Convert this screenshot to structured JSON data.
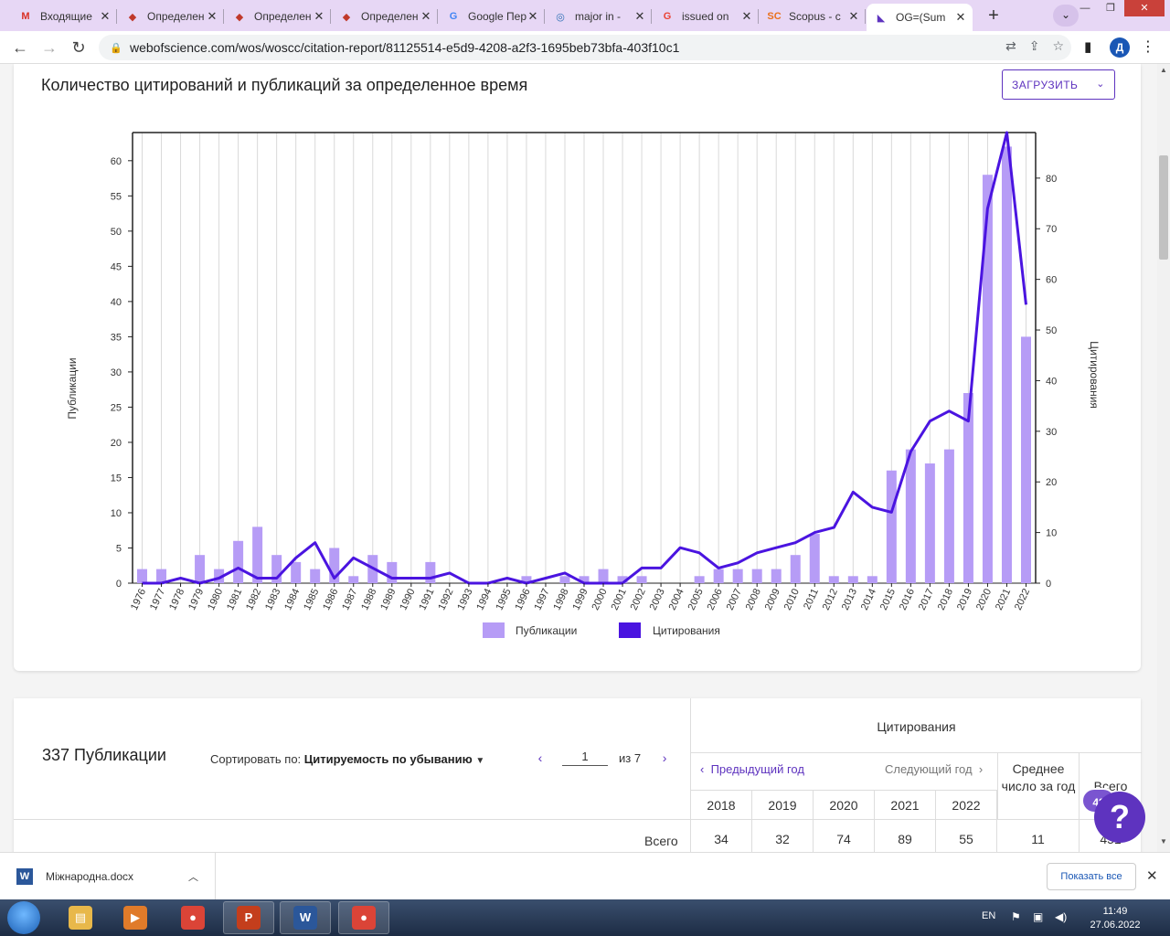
{
  "browser": {
    "tabs": [
      {
        "title": "Входящие",
        "icon": "gmail-icon",
        "icon_glyph": "M",
        "icon_color": "#d93025"
      },
      {
        "title": "Определен",
        "icon": "shield-icon",
        "icon_glyph": "◆",
        "icon_color": "#c0392b"
      },
      {
        "title": "Определен",
        "icon": "shield-icon",
        "icon_glyph": "◆",
        "icon_color": "#c0392b"
      },
      {
        "title": "Определен",
        "icon": "shield-icon",
        "icon_glyph": "◆",
        "icon_color": "#c0392b"
      },
      {
        "title": "Google Пер",
        "icon": "translate-icon",
        "icon_glyph": "G",
        "icon_color": "#4285f4"
      },
      {
        "title": "major in -",
        "icon": "search-icon",
        "icon_glyph": "◎",
        "icon_color": "#2c6fb5"
      },
      {
        "title": "issued on",
        "icon": "google-icon",
        "icon_glyph": "G",
        "icon_color": "#ea4335"
      },
      {
        "title": "Scopus - c",
        "icon": "scopus-icon",
        "icon_glyph": "SC",
        "icon_color": "#e9711c"
      },
      {
        "title": "OG=(Sum",
        "icon": "clarivate-icon",
        "icon_glyph": "◣",
        "icon_color": "#5e33bf"
      }
    ],
    "url": "webofscience.com/wos/woscc/citation-report/81125514-e5d9-4208-a2f3-1695beb73bfa-403f10c1",
    "profile_initial": "Д"
  },
  "chart_card": {
    "title": "Количество цитирований и публикаций за определенное время",
    "download_label": "ЗАГРУЗИТЬ"
  },
  "chart_data": {
    "type": "bar",
    "categories": [
      "1976",
      "1977",
      "1978",
      "1979",
      "1980",
      "1981",
      "1982",
      "1983",
      "1984",
      "1985",
      "1986",
      "1987",
      "1988",
      "1989",
      "1990",
      "1991",
      "1992",
      "1993",
      "1994",
      "1995",
      "1996",
      "1997",
      "1998",
      "1999",
      "2000",
      "2001",
      "2002",
      "2003",
      "2004",
      "2005",
      "2006",
      "2007",
      "2008",
      "2009",
      "2010",
      "2011",
      "2012",
      "2013",
      "2014",
      "2015",
      "2016",
      "2017",
      "2018",
      "2019",
      "2020",
      "2021",
      "2022"
    ],
    "series": [
      {
        "name": "Публикации",
        "type": "bar",
        "axis": "left",
        "color": "#b69cf6",
        "values": [
          2,
          2,
          0,
          4,
          2,
          6,
          8,
          4,
          3,
          2,
          5,
          1,
          4,
          3,
          0,
          3,
          0,
          0,
          0,
          0,
          1,
          0,
          1,
          1,
          2,
          1,
          1,
          0,
          0,
          1,
          2,
          2,
          2,
          2,
          4,
          7,
          1,
          1,
          1,
          16,
          19,
          17,
          19,
          27,
          58,
          62,
          35
        ]
      },
      {
        "name": "Цитирования",
        "type": "line",
        "axis": "right",
        "color": "#4a14e0",
        "values": [
          0,
          0,
          1,
          0,
          1,
          3,
          1,
          1,
          5,
          8,
          1,
          5,
          3,
          1,
          1,
          1,
          2,
          0,
          0,
          1,
          0,
          1,
          2,
          0,
          0,
          0,
          3,
          3,
          7,
          6,
          3,
          4,
          6,
          7,
          8,
          10,
          11,
          18,
          15,
          14,
          26,
          32,
          34,
          32,
          74,
          89,
          55
        ]
      }
    ],
    "ylabel": "Публикации",
    "y2label": "Цитирования",
    "ylim": [
      0,
      64
    ],
    "y2lim": [
      0,
      89
    ],
    "yticks": [
      0,
      5,
      10,
      15,
      20,
      25,
      30,
      35,
      40,
      45,
      50,
      55,
      60
    ],
    "y2ticks": [
      0,
      10,
      20,
      30,
      40,
      50,
      60,
      70,
      80
    ],
    "grid": "vertical",
    "legend": "bottom-center"
  },
  "table": {
    "publications_count": "337 Публикации",
    "sort_label": "Сортировать по:",
    "sort_value": "Цитируемость по убыванию",
    "page_current": "1",
    "page_total": "из 7",
    "citations_header": "Цитирования",
    "prev_year": "Предыдущий год",
    "next_year": "Следующий год",
    "avg_header": "Среднее число за год",
    "total_header": "Всего",
    "years": [
      "2018",
      "2019",
      "2020",
      "2021",
      "2022"
    ],
    "total_row_label": "Всего",
    "total_values": [
      "34",
      "32",
      "74",
      "89",
      "55"
    ],
    "avg_value": "11",
    "total_value": "451"
  },
  "help": {
    "badge": "43",
    "glyph": "?"
  },
  "download_shelf": {
    "file": "Міжнародна.docx",
    "show_all": "Показать все"
  },
  "taskbar": {
    "apps": [
      {
        "name": "explorer-icon",
        "glyph": "▤",
        "color": "#e8b84a"
      },
      {
        "name": "media-player-icon",
        "glyph": "▶",
        "color": "#e07b2a"
      },
      {
        "name": "chrome-icon",
        "glyph": "●",
        "color": "#db4437"
      },
      {
        "name": "powerpoint-icon",
        "glyph": "P",
        "color": "#c43e1c"
      },
      {
        "name": "word-icon",
        "glyph": "W",
        "color": "#2b579a"
      },
      {
        "name": "chrome-profile-icon",
        "glyph": "●",
        "color": "#db4437"
      }
    ],
    "lang": "EN",
    "time": "11:49",
    "date": "27.06.2022"
  }
}
